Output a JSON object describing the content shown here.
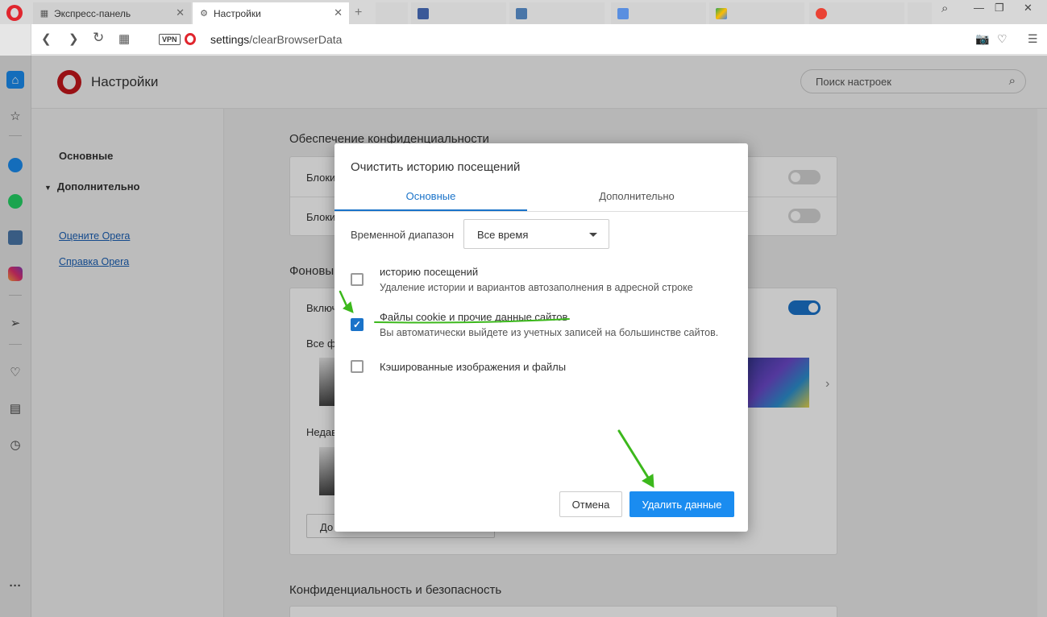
{
  "colors": {
    "accent": "#1a73c9",
    "opera_red": "#e0262e",
    "annotation_green": "#3cb81c"
  },
  "tabs": [
    {
      "label": "Экспресс-панель",
      "icon": "grid-icon",
      "active": false
    },
    {
      "label": "Настройки",
      "icon": "gear-icon",
      "active": true
    }
  ],
  "address": {
    "vpn": "VPN",
    "url_host": "settings",
    "url_path": "/clearBrowserData"
  },
  "settings": {
    "title": "Настройки",
    "search_placeholder": "Поиск настроек",
    "nav": {
      "basic": "Основные",
      "advanced": "Дополнительно",
      "rate": "Оцените Opera",
      "help": "Справка Opera"
    },
    "sections": {
      "privacy": "Обеспечение конфиденциальности",
      "block_row_1": "Блоки",
      "block_row_2": "Блоки",
      "background": "Фоновы",
      "include_row": "Включ",
      "all_row": "Все ф",
      "recent_row": "Недав",
      "add_btn": "До",
      "privacy_security": "Конфиденциальность и безопасность"
    }
  },
  "dialog": {
    "title": "Очистить историю посещений",
    "tabs": {
      "basic": "Основные",
      "advanced": "Дополнительно"
    },
    "range_label": "Временной диапазон",
    "range_value": "Все время",
    "options": [
      {
        "title": "историю посещений",
        "desc": "Удаление истории и вариантов автозаполнения в адресной строке",
        "checked": false
      },
      {
        "title": "Файлы cookie и прочие данные сайтов",
        "desc": "Вы автоматически выйдете из учетных записей на большинстве сайтов.",
        "checked": true
      },
      {
        "title": "Кэшированные изображения и файлы",
        "desc": "",
        "checked": false
      }
    ],
    "cancel": "Отмена",
    "delete": "Удалить данные"
  }
}
